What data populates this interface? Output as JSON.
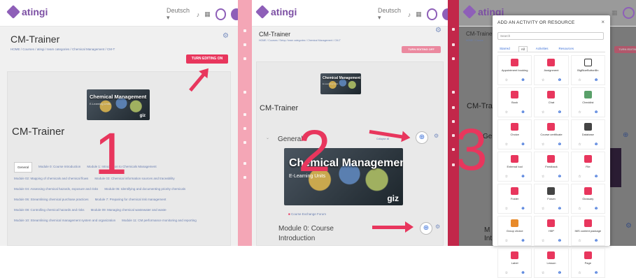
{
  "brand": {
    "name": "atingi",
    "color": "#8e5fb8",
    "accent": "#e8365d"
  },
  "panel1": {
    "course_title": "CM-Trainer",
    "breadcrumb": "HOME / Courses / atingi / team categories / Chemical Management / CM-T",
    "turn_editing": "TURN EDITING ON",
    "banner_title": "Chemical Management",
    "banner_sub": "E-Learning Units",
    "banner_giz": "giz",
    "course_name": "CM-Trainer",
    "step": "1",
    "tabs": [
      "General",
      "Module 0: Course Introduction",
      "Module 1: Introduction to Chemicals Management",
      "Module 02: Mapping of chemicals and chemical flows",
      "Module 03: Chemical information sources and traceability",
      "Module 04: Assessing chemical hazards, exposure and risks",
      "Module 05: Identifying and documenting priority chemicals",
      "Module 06: Streamlining chemical purchase practices",
      "Module 7: Preparing for chemical risk management",
      "Module 08: Controlling chemical hazards and risks",
      "Module 09: Managing chemical wastewater and waste",
      "Module 10: Streamlining chemical management system and organization",
      "Module 11: CM performance monitoring and reporting"
    ]
  },
  "panel2": {
    "course_title": "CM-Trainer",
    "breadcrumb": "HOME / Courses / Setup / team categories / Chemical Management / CM-T",
    "turn_editing": "TURN EDITING OFF",
    "course_name": "CM-Trainer",
    "banner_title": "Chemical Management",
    "banner_sub": "E-Learning Units",
    "banner_giz": "giz",
    "section_general": "General",
    "collapse_all": "Collapse all",
    "forum_link": "Course Exchange Forum",
    "module0_line1": "Module 0: Course",
    "module0_line2": "Introduction",
    "step": "2"
  },
  "panel3": {
    "course_title": "CM-Traine",
    "breadcrumb": "HOME / Course",
    "course_name": "CM-Trai",
    "section_general": "Ge",
    "turn_editing": "TURN EDITING OFF",
    "module_partial": "M",
    "intro_partial": "Int",
    "step": "3"
  },
  "modal": {
    "title": "ADD AN ACTIVITY OR RESOURCE",
    "close": "×",
    "search_placeholder": "Search",
    "tabs": [
      "Starred",
      "All",
      "Activities",
      "Resources"
    ],
    "items": [
      {
        "name": "Appointment booking",
        "icon": "red"
      },
      {
        "name": "Assignment",
        "icon": "red"
      },
      {
        "name": "BigBlueButtonBn",
        "icon": "dark"
      },
      {
        "name": "Book",
        "icon": "red"
      },
      {
        "name": "Chat",
        "icon": "red"
      },
      {
        "name": "Checklist",
        "icon": "green"
      },
      {
        "name": "Choice",
        "icon": "red"
      },
      {
        "name": "Course certificate",
        "icon": "red"
      },
      {
        "name": "Database",
        "icon": "gray"
      },
      {
        "name": "External tool",
        "icon": "red"
      },
      {
        "name": "Feedback",
        "icon": "red"
      },
      {
        "name": "File",
        "icon": "red"
      },
      {
        "name": "Folder",
        "icon": "red"
      },
      {
        "name": "Forum",
        "icon": "gray"
      },
      {
        "name": "Glossary",
        "icon": "red"
      },
      {
        "name": "Group choice",
        "icon": "orange"
      },
      {
        "name": "H5P",
        "icon": "red"
      },
      {
        "name": "IMS content package",
        "icon": "red"
      },
      {
        "name": "Label",
        "icon": "red"
      },
      {
        "name": "Lesson",
        "icon": "red"
      },
      {
        "name": "Page",
        "icon": "red"
      }
    ],
    "star": "☆",
    "info": "❶"
  }
}
